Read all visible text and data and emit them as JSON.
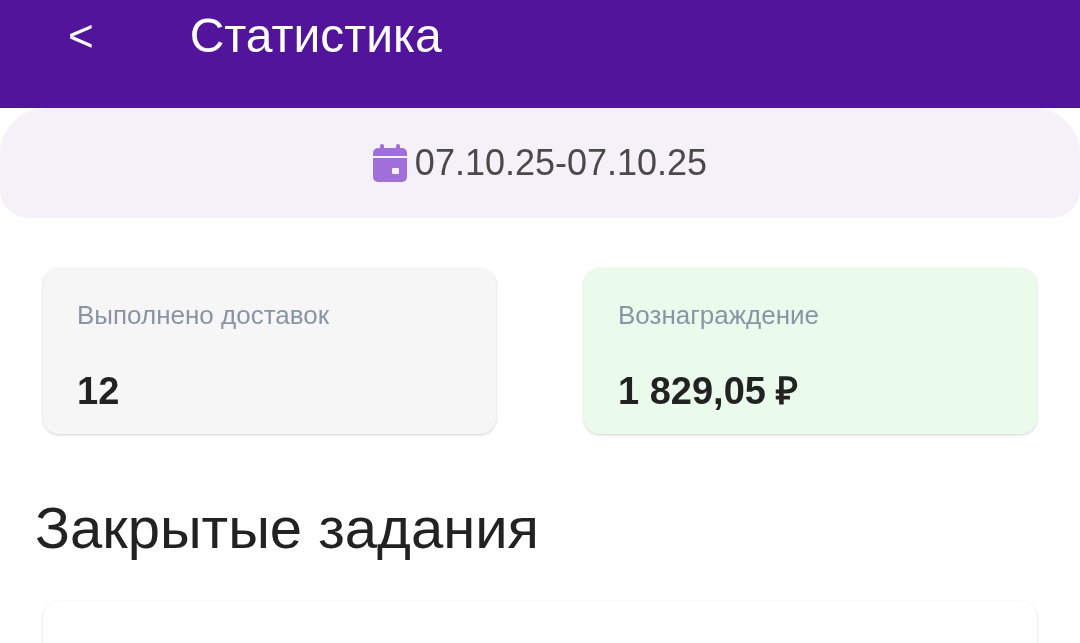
{
  "header": {
    "back": "<",
    "title": "Статистика"
  },
  "period": {
    "dates": "07.10.25-07.10.25"
  },
  "summary": [
    {
      "label": "Выполнено доставок",
      "value": "12",
      "color": "#f6f6f6"
    },
    {
      "label": "Вознаграждение",
      "value": "1 829,05 ₽",
      "color": "#eafbec"
    }
  ],
  "section": {
    "title": "Закрытые задания"
  }
}
